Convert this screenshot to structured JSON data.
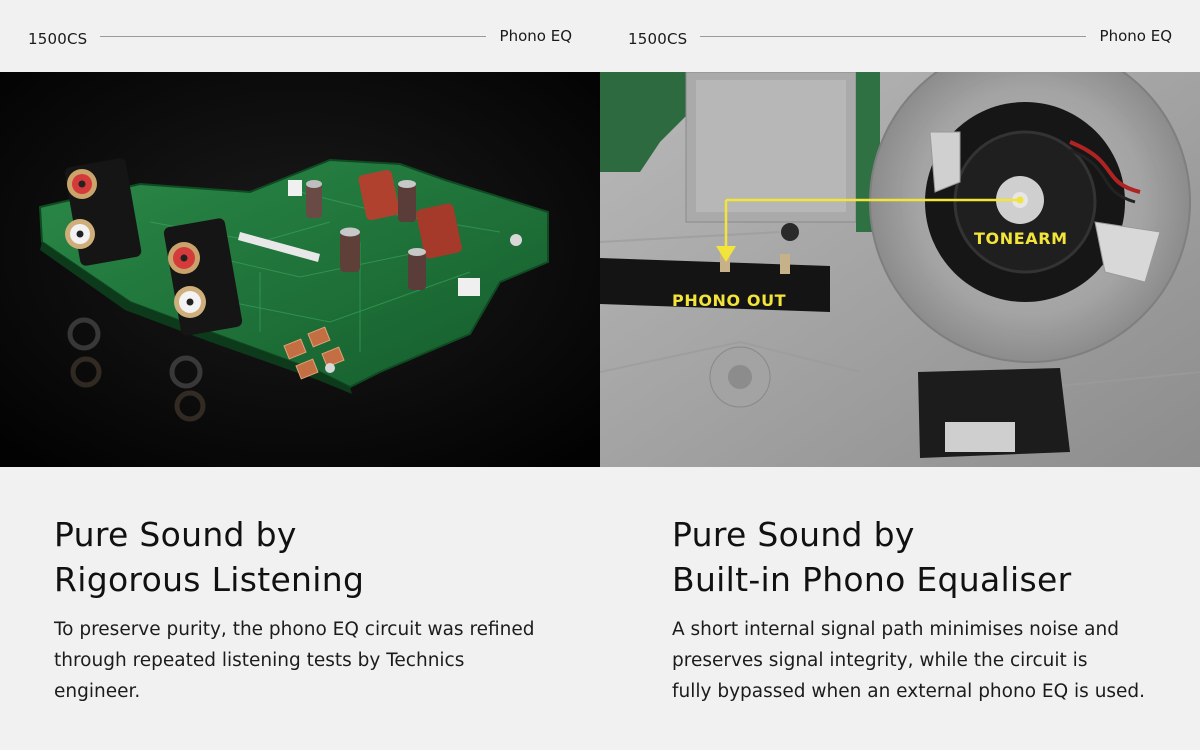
{
  "left": {
    "model": "1500CS",
    "section": "Phono EQ",
    "heading_line1": "Pure Sound by",
    "heading_line2": "Rigorous Listening",
    "body_line1": "To preserve purity, the phono EQ circuit was refined",
    "body_line2": "through repeated listening tests by Technics",
    "body_line3": "engineer.",
    "image_icon": "phono-eq-circuit-board-photo"
  },
  "right": {
    "model": "1500CS",
    "section": "Phono EQ",
    "heading_line1": "Pure Sound by",
    "heading_line2": "Built-in Phono Equaliser",
    "body_line1": "A short internal signal path minimises noise and",
    "body_line2": "preserves signal integrity, while the circuit is",
    "body_line3": "fully bypassed when an external phono EQ is used.",
    "image_icon": "turntable-underside-photo",
    "label_tonearm": "TONEARM",
    "label_phono_out": "PHONO OUT"
  },
  "colors": {
    "background": "#f1f1f1",
    "text": "#141414",
    "divider": "#9a9a9a",
    "callout": "#f2e43a",
    "pcb_green": "#1f7a3e"
  }
}
